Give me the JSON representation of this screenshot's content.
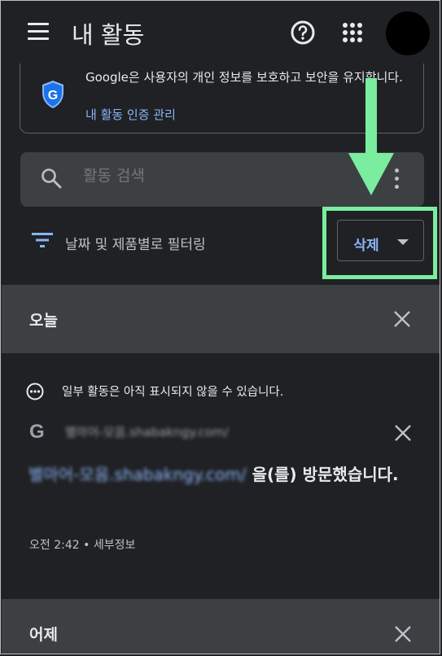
{
  "header": {
    "title": "내 활동"
  },
  "security_card": {
    "text": "Google은 사용자의 개인 정보를 보호하고 보안을 유지합니다.",
    "link": "내 활동 인증 관리"
  },
  "search": {
    "placeholder": "활동 검색"
  },
  "filter": {
    "label": "날짜 및 제품별로 필터링"
  },
  "delete_button": {
    "label": "삭제"
  },
  "sections": {
    "today": {
      "title": "오늘"
    },
    "yesterday": {
      "title": "어제"
    }
  },
  "notice": "일부 활동은 아직 표시되지 않을 수 있습니다.",
  "activity": {
    "g_letter": "G",
    "site_url": "별마어-모음.shabakngy.com/",
    "visit_link": "별마어-모음.shabakngy.com/",
    "visit_suffix": " 을(를) 방문했습니다.",
    "time": "오전 2:42",
    "separator": " • ",
    "details": "세부정보"
  },
  "colors": {
    "background": "#202124",
    "section_header": "#3c4043",
    "accent_blue": "#8ab4f8",
    "highlight_green": "#7bed9f"
  },
  "icons": [
    "menu-icon",
    "help-icon",
    "apps-icon",
    "shield-icon",
    "search-icon",
    "more-vert-icon",
    "filter-icon",
    "dropdown-icon",
    "close-icon",
    "info-icon",
    "arrow-icon"
  ]
}
